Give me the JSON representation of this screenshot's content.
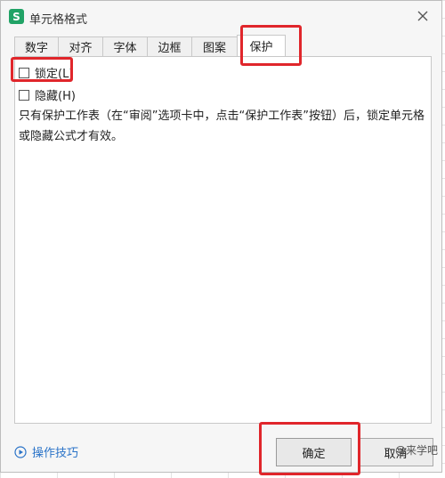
{
  "window": {
    "title": "单元格格式",
    "app_logo_letter": "S"
  },
  "tabs": [
    {
      "label": "数字"
    },
    {
      "label": "对齐"
    },
    {
      "label": "字体"
    },
    {
      "label": "边框"
    },
    {
      "label": "图案"
    },
    {
      "label": "保护",
      "active": true
    }
  ],
  "protection": {
    "locked": {
      "label": "锁定(L)",
      "checked": false
    },
    "hidden": {
      "label": "隐藏(H)",
      "checked": false
    },
    "help_text": "只有保护工作表（在“审阅”选项卡中，点击“保护工作表”按钮）后，锁定单元格或隐藏公式才有效。"
  },
  "footer": {
    "tips_label": "操作技巧",
    "ok_label": "确定",
    "cancel_label": "取消"
  },
  "watermark": "@来学吧",
  "colors": {
    "highlight": "#e0262b",
    "link": "#2a73c8",
    "app_logo": "#21a366"
  }
}
